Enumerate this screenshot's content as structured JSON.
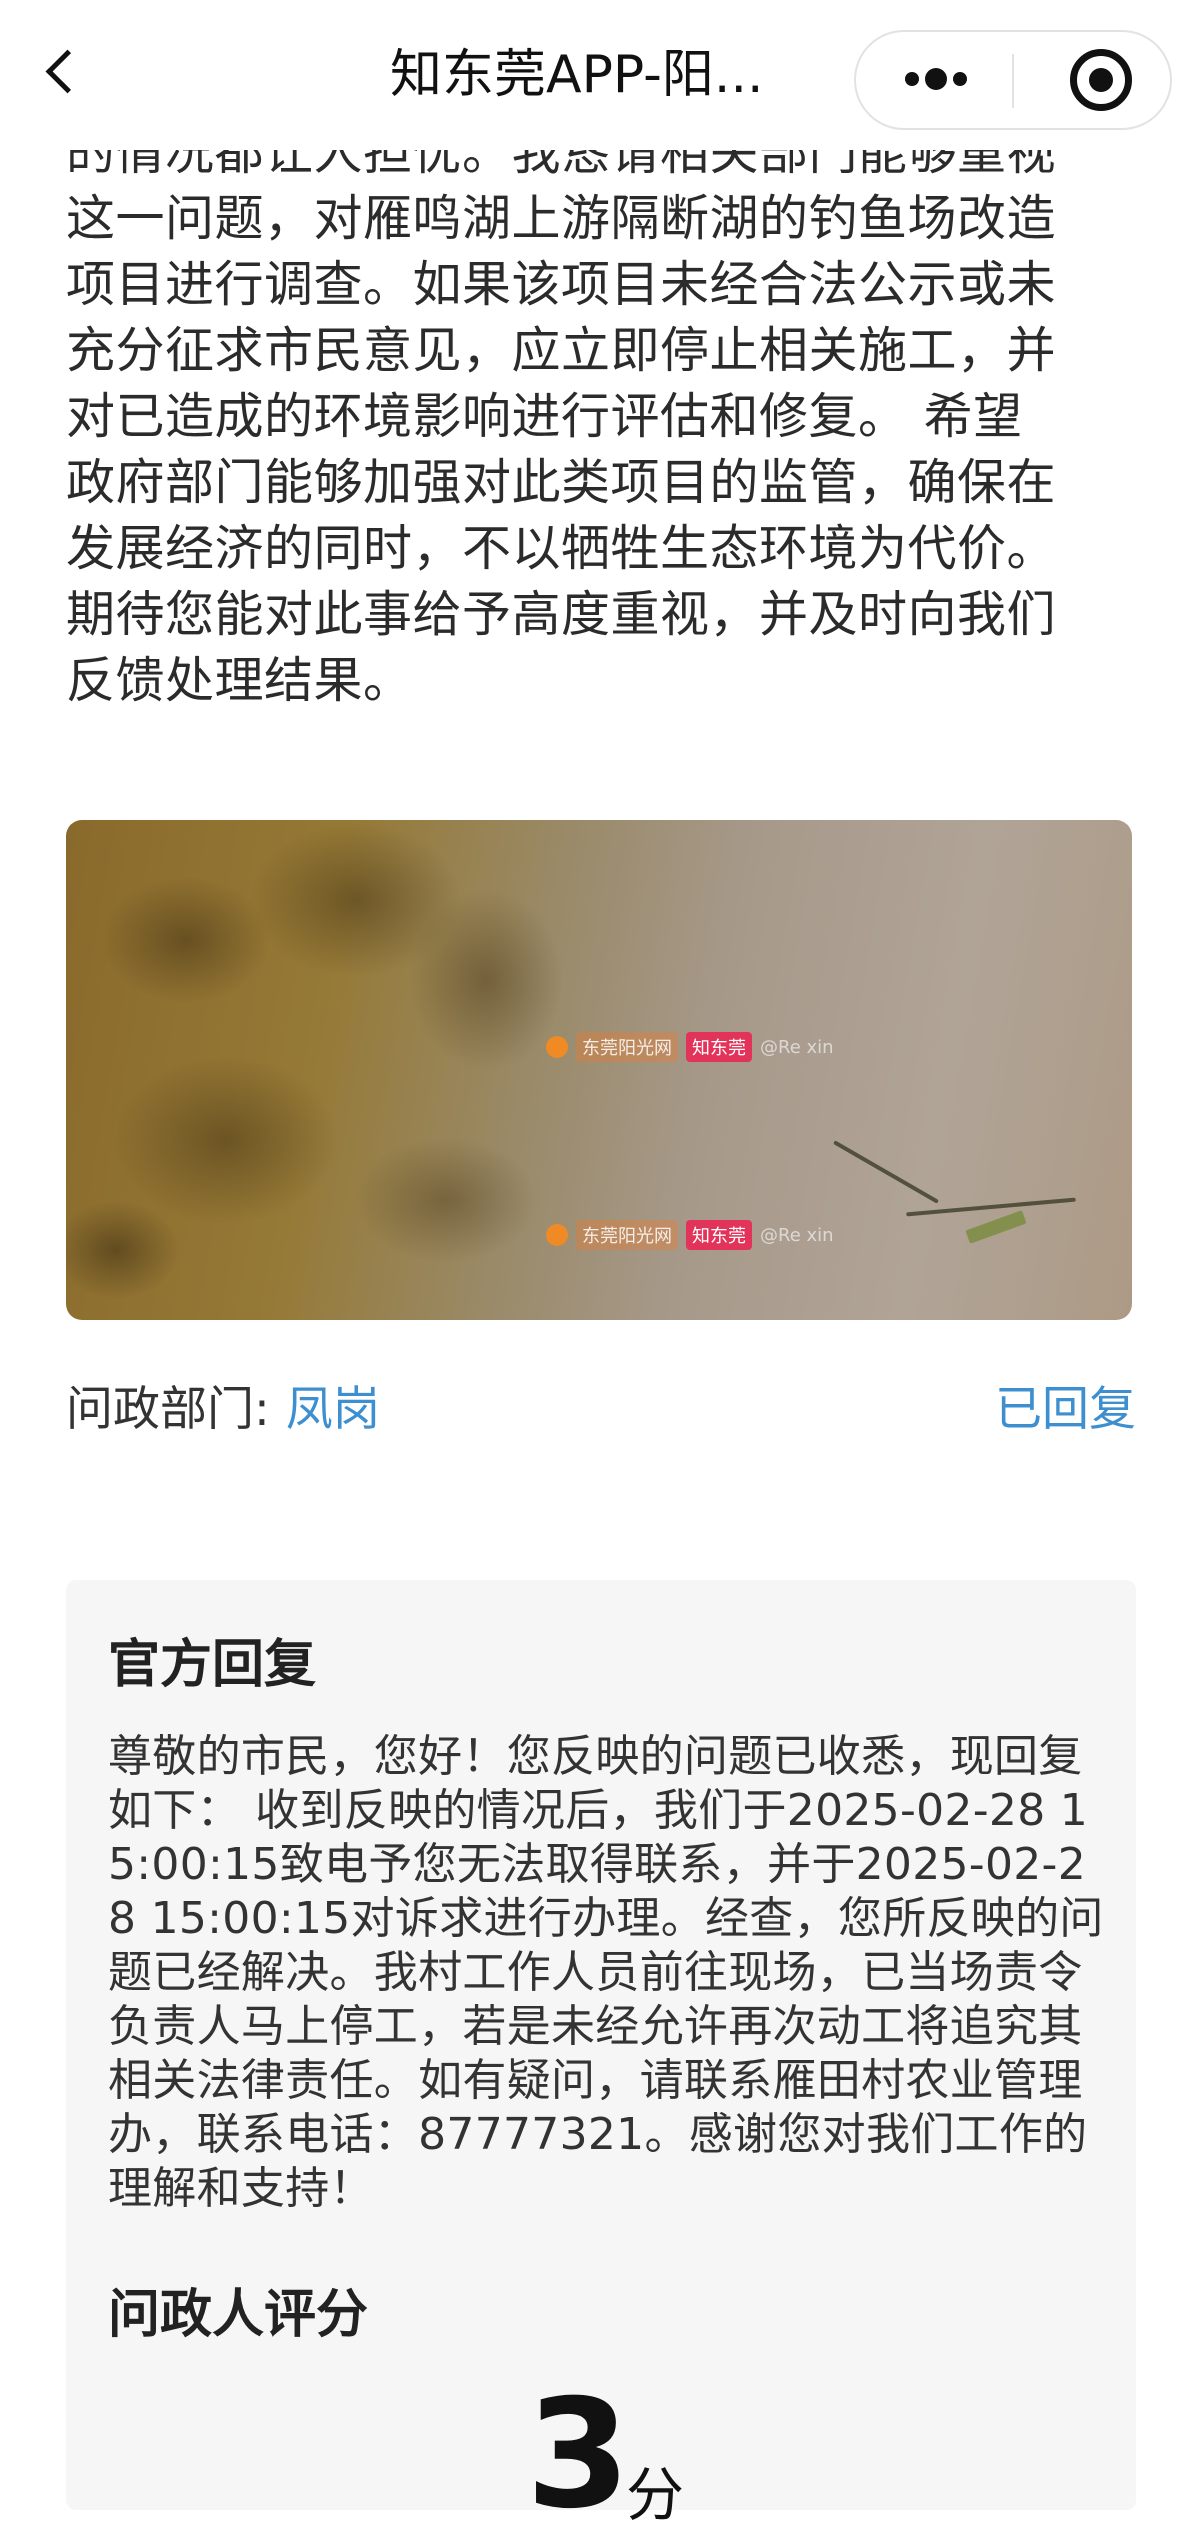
{
  "nav": {
    "title": "知东莞APP-阳..."
  },
  "article": {
    "lines": [
      "的情况都让人担忧。我恳请相关部门能够重视",
      "这一问题，对雁鸣湖上游隔断湖的钓鱼场改造",
      "项目进行调查。如果该项目未经合法公示或未",
      "充分征求市民意见，应立即停止相关施工，并",
      "对已造成的环境影响进行评估和修复。 希望",
      "政府部门能够加强对此类项目的监管，确保在",
      "发展经济的同时，不以牺牲生态环境为代价。",
      "期待您能对此事给予高度重视，并及时向我们",
      "反馈处理结果。"
    ]
  },
  "photo": {
    "watermark_brand": "东莞阳光网",
    "watermark_app": "知东莞",
    "watermark_user": "@Re xin"
  },
  "department": {
    "label": "问政部门:",
    "value": "凤岗",
    "status": "已回复"
  },
  "reply": {
    "title": "官方回复",
    "body": "尊敬的市民，您好！您反映的问题已收悉，现回复如下： 收到反映的情况后，我们于2025-02-28 15:00:15致电予您无法取得联系，并于2025-02-28 15:00:15对诉求进行办理。经查，您所反映的问题已经解决。我村工作人员前往现场，已当场责令负责人马上停工，若是未经允许再次动工将追究其相关法律责任。如有疑问，请联系雁田村农业管理办，联系电话：87777321。感谢您对我们工作的理解和支持！"
  },
  "rating": {
    "title": "问政人评分",
    "score": "3",
    "unit": "分"
  }
}
